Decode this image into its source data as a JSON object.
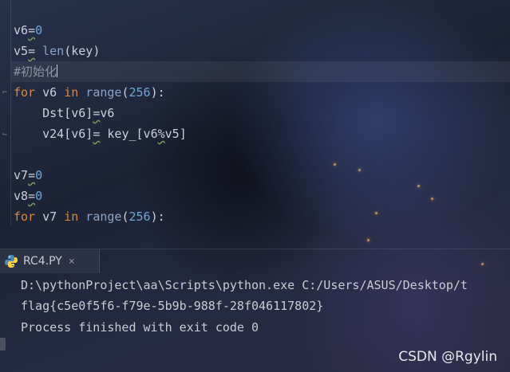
{
  "editor": {
    "lines": [
      [
        {
          "t": "v6",
          "c": ""
        },
        {
          "t": "=",
          "c": "op"
        },
        {
          "t": "0",
          "c": "num"
        }
      ],
      [
        {
          "t": "v5",
          "c": ""
        },
        {
          "t": "=",
          "c": "op"
        },
        {
          "t": " len",
          "c": "bi"
        },
        {
          "t": "(key)",
          "c": ""
        }
      ],
      [
        {
          "t": "#初始化",
          "c": "cm"
        },
        {
          "t": "",
          "c": "caret"
        }
      ],
      [
        {
          "t": "for",
          "c": "kw"
        },
        {
          "t": " v6 ",
          "c": ""
        },
        {
          "t": "in",
          "c": "kw"
        },
        {
          "t": " range",
          "c": "bi"
        },
        {
          "t": "(",
          "c": ""
        },
        {
          "t": "256",
          "c": "num"
        },
        {
          "t": "):",
          "c": ""
        }
      ],
      [
        {
          "t": "    Dst[v6]",
          "c": ""
        },
        {
          "t": "=",
          "c": "op"
        },
        {
          "t": "v6",
          "c": ""
        }
      ],
      [
        {
          "t": "    v24[v6]",
          "c": ""
        },
        {
          "t": "=",
          "c": "op"
        },
        {
          "t": " key_[v6",
          "c": ""
        },
        {
          "t": "%",
          "c": "op"
        },
        {
          "t": "v5]",
          "c": ""
        }
      ],
      [],
      [
        {
          "t": "v7",
          "c": ""
        },
        {
          "t": "=",
          "c": "op"
        },
        {
          "t": "0",
          "c": "num"
        }
      ],
      [
        {
          "t": "v8",
          "c": ""
        },
        {
          "t": "=",
          "c": "op"
        },
        {
          "t": "0",
          "c": "num"
        }
      ],
      [
        {
          "t": "for",
          "c": "kw"
        },
        {
          "t": " v7 ",
          "c": ""
        },
        {
          "t": "in",
          "c": "kw"
        },
        {
          "t": " range",
          "c": "bi"
        },
        {
          "t": "(",
          "c": ""
        },
        {
          "t": "256",
          "c": "num"
        },
        {
          "t": "):",
          "c": ""
        }
      ]
    ]
  },
  "run": {
    "tab_label": "RC4.PY",
    "close_glyph": "×",
    "output": [
      "D:\\pythonProject\\aa\\Scripts\\python.exe C:/Users/ASUS/Desktop/t",
      "flag{c5e0f5f6-f79e-5b9b-988f-28f046117802}",
      "Process finished with exit code 0"
    ]
  },
  "watermark": "CSDN @Rgylin",
  "icons": {
    "tab": "python-file-icon",
    "close": "close-icon"
  },
  "colors": {
    "keyword": "#d9893a",
    "number": "#6fa7d6",
    "builtin": "#8aa3c6",
    "comment": "#8c93a0",
    "text": "#c9d1dc"
  }
}
